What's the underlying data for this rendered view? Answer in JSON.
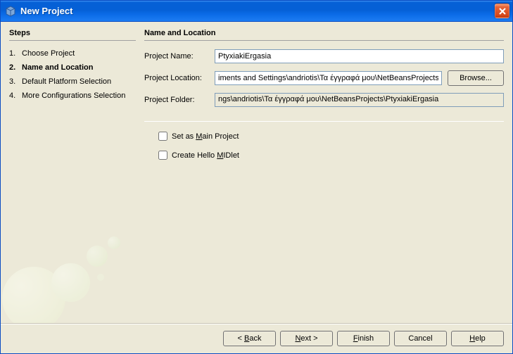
{
  "window": {
    "title": "New Project"
  },
  "steps": {
    "heading": "Steps",
    "items": [
      {
        "num": "1.",
        "label": "Choose Project"
      },
      {
        "num": "2.",
        "label": "Name and Location"
      },
      {
        "num": "3.",
        "label": "Default Platform Selection"
      },
      {
        "num": "4.",
        "label": "More Configurations Selection"
      }
    ],
    "current_index": 1
  },
  "panel": {
    "heading": "Name and Location",
    "project_name": {
      "label": "Project Name:",
      "value": "PtyxiakiErgasia"
    },
    "project_location": {
      "label": "Project Location:",
      "value": "iments and Settings\\andriotis\\Τα έγγραφά μου\\NetBeansProjects",
      "browse": "Browse..."
    },
    "project_folder": {
      "label": "Project Folder:",
      "value": "ngs\\andriotis\\Τα έγγραφά μου\\NetBeansProjects\\PtyxiakiErgasia"
    },
    "set_main": {
      "pre": "Set as ",
      "u": "M",
      "post": "ain Project",
      "checked": false
    },
    "create_midlet": {
      "pre": "Create Hello ",
      "u": "M",
      "post": "IDlet",
      "checked": false
    }
  },
  "buttons": {
    "back": {
      "pre": "< ",
      "u": "B",
      "post": "ack"
    },
    "next": {
      "pre": "",
      "u": "N",
      "post": "ext >"
    },
    "finish": {
      "pre": "",
      "u": "F",
      "post": "inish"
    },
    "cancel": {
      "label": "Cancel"
    },
    "help": {
      "pre": "",
      "u": "H",
      "post": "elp"
    }
  }
}
